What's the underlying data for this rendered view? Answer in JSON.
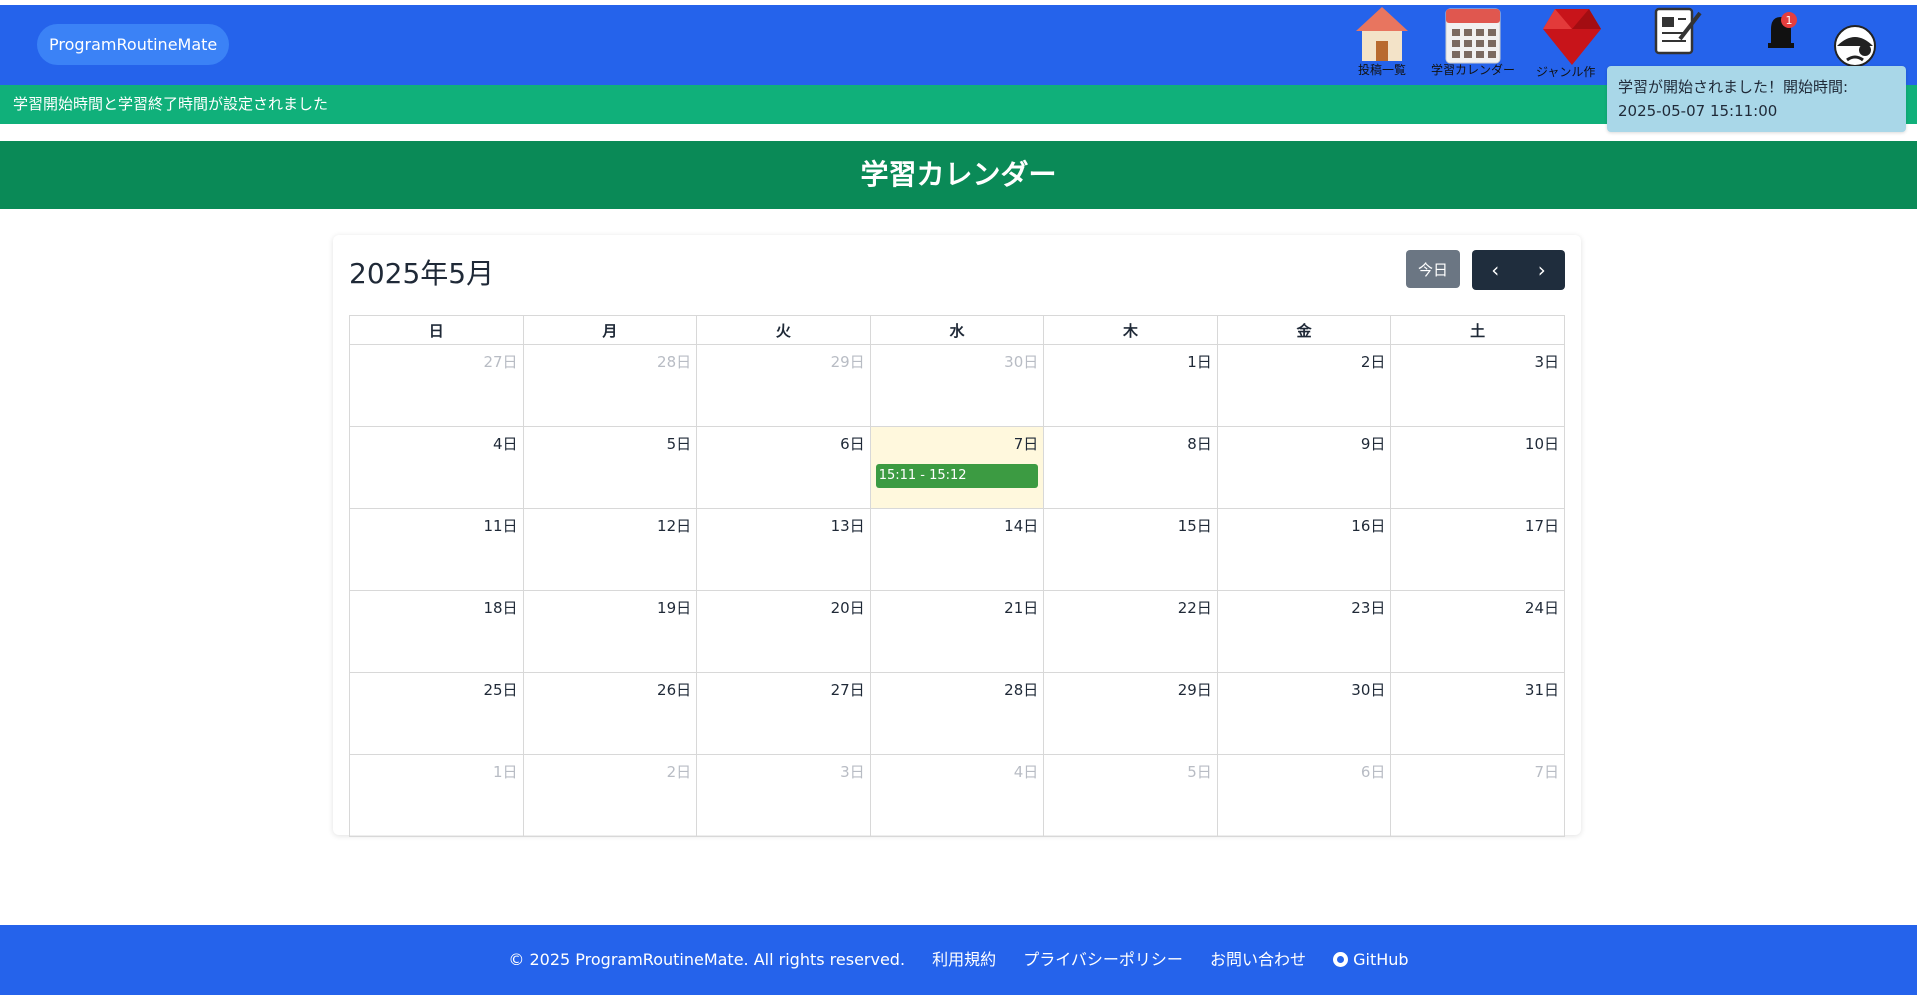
{
  "header": {
    "brand": "ProgramRoutineMate",
    "nav": [
      {
        "icon": "house-icon",
        "label": "投稿一覧"
      },
      {
        "icon": "calendar-icon",
        "label": "学習カレンダー"
      },
      {
        "icon": "ruby-gem-icon",
        "label": "ジャンル作"
      },
      {
        "icon": "notepad-icon",
        "label": ""
      },
      {
        "icon": "bell-icon",
        "label": "",
        "badge": "1"
      },
      {
        "icon": "avatar-icon",
        "label": ""
      }
    ]
  },
  "flash": {
    "message": "学習開始時間と学習終了時間が設定されました"
  },
  "toast": {
    "line1": "学習が開始されました！開始時間:",
    "line2": "2025-05-07 15:11:00"
  },
  "page": {
    "title": "学習カレンダー"
  },
  "calendar": {
    "title": "2025年5月",
    "today_label": "今日",
    "prev_label": "‹",
    "next_label": "›",
    "weekdays": [
      "日",
      "月",
      "火",
      "水",
      "木",
      "金",
      "土"
    ],
    "weeks": [
      [
        {
          "d": "27日",
          "o": true
        },
        {
          "d": "28日",
          "o": true
        },
        {
          "d": "29日",
          "o": true
        },
        {
          "d": "30日",
          "o": true
        },
        {
          "d": "1日"
        },
        {
          "d": "2日"
        },
        {
          "d": "3日"
        }
      ],
      [
        {
          "d": "4日"
        },
        {
          "d": "5日"
        },
        {
          "d": "6日"
        },
        {
          "d": "7日",
          "today": true,
          "event": "15:11 - 15:12"
        },
        {
          "d": "8日"
        },
        {
          "d": "9日"
        },
        {
          "d": "10日"
        }
      ],
      [
        {
          "d": "11日"
        },
        {
          "d": "12日"
        },
        {
          "d": "13日"
        },
        {
          "d": "14日"
        },
        {
          "d": "15日"
        },
        {
          "d": "16日"
        },
        {
          "d": "17日"
        }
      ],
      [
        {
          "d": "18日"
        },
        {
          "d": "19日"
        },
        {
          "d": "20日"
        },
        {
          "d": "21日"
        },
        {
          "d": "22日"
        },
        {
          "d": "23日"
        },
        {
          "d": "24日"
        }
      ],
      [
        {
          "d": "25日"
        },
        {
          "d": "26日"
        },
        {
          "d": "27日"
        },
        {
          "d": "28日"
        },
        {
          "d": "29日"
        },
        {
          "d": "30日"
        },
        {
          "d": "31日"
        }
      ],
      [
        {
          "d": "1日",
          "o": true
        },
        {
          "d": "2日",
          "o": true
        },
        {
          "d": "3日",
          "o": true
        },
        {
          "d": "4日",
          "o": true
        },
        {
          "d": "5日",
          "o": true
        },
        {
          "d": "6日",
          "o": true
        },
        {
          "d": "7日",
          "o": true
        }
      ]
    ]
  },
  "footer": {
    "copyright": "© 2025 ProgramRoutineMate. All rights reserved.",
    "terms": "利用規約",
    "privacy": "プライバシーポリシー",
    "contact": "お問い合わせ",
    "github": "GitHub"
  },
  "colors": {
    "header": "#2563eb",
    "flash": "#10b07a",
    "title_band": "#0a8a57",
    "event": "#3c9b42",
    "today_bg": "#fff8dd"
  }
}
